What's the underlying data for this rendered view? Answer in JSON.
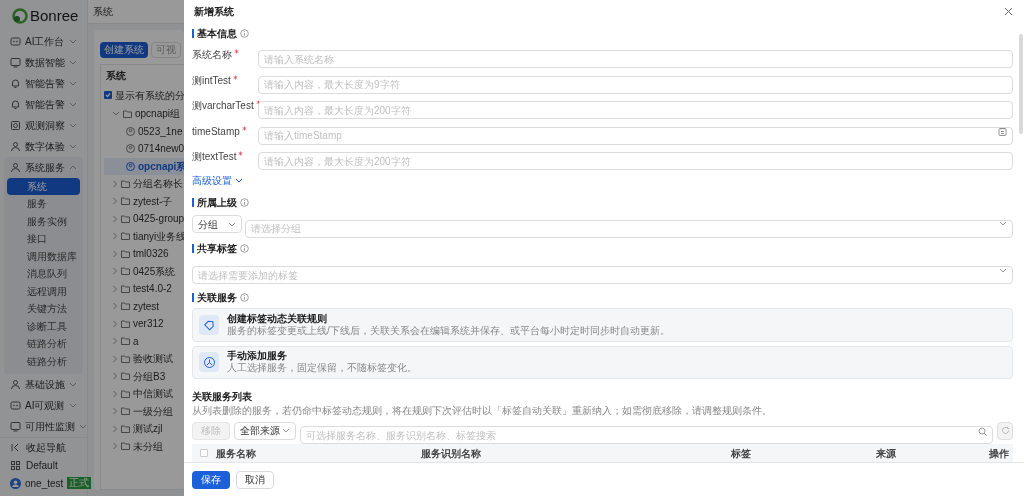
{
  "sidebar": {
    "logo": "Bonree",
    "items": [
      {
        "label": "AI工作台",
        "expanded": false
      },
      {
        "label": "数据智能",
        "expanded": false
      },
      {
        "label": "智能告警",
        "expanded": false
      },
      {
        "label": "智能告警",
        "expanded": false
      },
      {
        "label": "观测洞察",
        "expanded": false
      },
      {
        "label": "数字体验",
        "expanded": false
      },
      {
        "label": "系统服务",
        "expanded": true,
        "children": [
          {
            "label": "系统",
            "selected": true
          },
          {
            "label": "服务",
            "selected": false
          },
          {
            "label": "服务实例",
            "selected": false
          },
          {
            "label": "接口",
            "selected": false
          },
          {
            "label": "调用数据库",
            "selected": false
          },
          {
            "label": "消息队列",
            "selected": false
          },
          {
            "label": "远程调用",
            "selected": false
          },
          {
            "label": "关键方法",
            "selected": false
          },
          {
            "label": "诊断工具",
            "selected": false
          },
          {
            "label": "链路分析",
            "selected": false
          },
          {
            "label": "链路分析",
            "selected": false
          }
        ]
      },
      {
        "label": "基础设施",
        "expanded": false
      },
      {
        "label": "AI可观测",
        "expanded": false
      },
      {
        "label": "可用性监测",
        "expanded": false
      }
    ],
    "footer": [
      {
        "label": "收起导航"
      },
      {
        "label": "Default"
      }
    ],
    "user": {
      "name": "one_test",
      "badge": "正式"
    }
  },
  "page": {
    "breadcrumb": "系统",
    "buttons": [
      {
        "label": "创建系统",
        "kind": "primary"
      },
      {
        "label": "可视",
        "kind": "default"
      }
    ],
    "tree": {
      "header": "系统",
      "show_groups": {
        "label": "显示有系统的分",
        "checked": true
      },
      "nodes": [
        {
          "label": "opcnapi组",
          "kind": "folder",
          "expanded": true,
          "selected": false,
          "children": [
            {
              "label": "0523_1ne",
              "kind": "system",
              "selected": false
            },
            {
              "label": "0714new0",
              "kind": "system",
              "selected": false
            },
            {
              "label": "opcnapi系",
              "kind": "system",
              "selected": true
            }
          ]
        },
        {
          "label": "分组名称长",
          "kind": "folder",
          "expanded": false,
          "selected": false
        },
        {
          "label": "zytest-子",
          "kind": "folder",
          "expanded": false,
          "selected": false
        },
        {
          "label": "0425-group",
          "kind": "folder",
          "expanded": false,
          "selected": false
        },
        {
          "label": "tianyi业务线",
          "kind": "folder",
          "expanded": false,
          "selected": false
        },
        {
          "label": "tml0326",
          "kind": "folder",
          "expanded": false,
          "selected": false
        },
        {
          "label": "0425系统",
          "kind": "folder",
          "expanded": false,
          "selected": false
        },
        {
          "label": "test4.0-2",
          "kind": "folder",
          "expanded": false,
          "selected": false
        },
        {
          "label": "zytest",
          "kind": "folder",
          "expanded": false,
          "selected": false
        },
        {
          "label": "ver312",
          "kind": "folder",
          "expanded": false,
          "selected": false
        },
        {
          "label": "a",
          "kind": "folder",
          "expanded": false,
          "selected": false
        },
        {
          "label": "验收测试",
          "kind": "folder",
          "expanded": false,
          "selected": false
        },
        {
          "label": "分组B3",
          "kind": "folder",
          "expanded": false,
          "selected": false
        },
        {
          "label": "中信测试",
          "kind": "folder",
          "expanded": false,
          "selected": false
        },
        {
          "label": "一级分组",
          "kind": "folder",
          "expanded": false,
          "selected": false
        },
        {
          "label": "测试zjl",
          "kind": "folder",
          "expanded": false,
          "selected": false
        },
        {
          "label": "未分组",
          "kind": "folder",
          "expanded": false,
          "selected": false
        }
      ]
    }
  },
  "drawer": {
    "title": "新增系统",
    "basic": {
      "title": "基本信息",
      "fields": [
        {
          "label": "系统名称",
          "required": true,
          "placeholder": "请输入系统名称",
          "kind": "text"
        },
        {
          "label": "测intTest",
          "required": true,
          "placeholder": "请输入内容，最大长度为9字符",
          "kind": "text"
        },
        {
          "label": "测varcharTest",
          "required": true,
          "placeholder": "请输入内容，最大长度为200字符",
          "kind": "text"
        },
        {
          "label": "timeStamp",
          "required": true,
          "placeholder": "请输入timeStamp",
          "kind": "date"
        },
        {
          "label": "测textTest",
          "required": true,
          "placeholder": "请输入内容，最大长度为200字符",
          "kind": "text"
        }
      ],
      "advanced_link": "高级设置"
    },
    "parent": {
      "title": "所属上级",
      "type_value": "分组",
      "placeholder": "请选择分组"
    },
    "tags": {
      "title": "共享标签",
      "placeholder": "请选择需要添加的标签"
    },
    "services": {
      "title": "关联服务",
      "options": [
        {
          "title": "创建标签动态关联规则",
          "description": "服务的标签变更或上线/下线后，关联关系会在编辑系统并保存、或平台每小时定时同步时自动更新。"
        },
        {
          "title": "手动添加服务",
          "description": "人工选择服务，固定保留，不随标签变化。"
        }
      ]
    },
    "service_list": {
      "title": "关联服务列表",
      "description": "从列表删除的服务，若仍命中标签动态规则，将在规则下次评估时以「标签自动关联」重新纳入；如需彻底移除，请调整规则条件。",
      "remove_button": {
        "label": "移除",
        "disabled": true
      },
      "source_value": "全部来源",
      "search_placeholder": "可选择服务名称、服务识别名称、标签搜索",
      "select_all": {
        "checked": false
      },
      "columns": [
        "服务名称",
        "服务识别名称",
        "标签",
        "来源",
        "操作"
      ]
    },
    "footer_buttons": [
      {
        "label": "保存",
        "kind": "primary"
      },
      {
        "label": "取消",
        "kind": "default"
      }
    ]
  }
}
